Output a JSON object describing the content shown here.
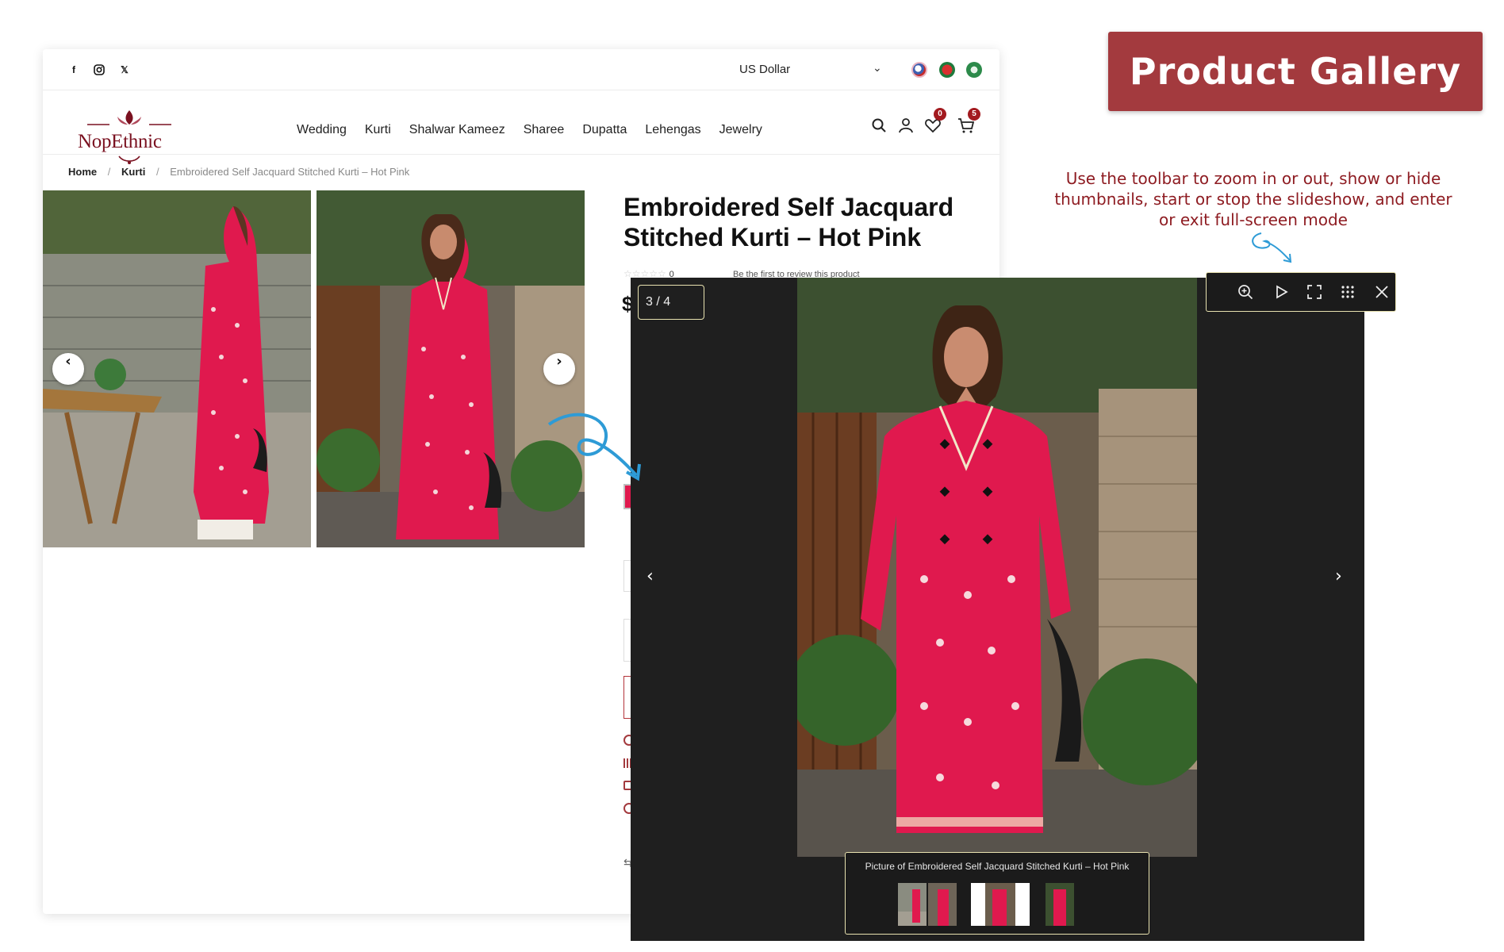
{
  "social": [
    "f",
    "ig",
    "x"
  ],
  "currency": {
    "label": "US Dollar"
  },
  "logo": {
    "name": "NopEthnic"
  },
  "nav": [
    "Wedding",
    "Kurti",
    "Shalwar Kameez",
    "Sharee",
    "Dupatta",
    "Lehengas",
    "Jewelry"
  ],
  "header_badges": {
    "wishlist": "0",
    "cart": "5"
  },
  "breadcrumb": {
    "home": "Home",
    "category": "Kurti",
    "current": "Embroidered Self Jacquard Stitched Kurti – Hot Pink"
  },
  "product": {
    "title": "Embroidered Self Jacquard Stitched Kurti – Hot Pink",
    "rating_count": "0",
    "review_link": "Be the first to review this product",
    "price_symbol": "$"
  },
  "lightbox": {
    "counter": "3 / 4",
    "caption": "Picture of Embroidered Self Jacquard Stitched Kurti – Hot Pink"
  },
  "annotation": {
    "tag": "Product Gallery",
    "note": "Use the toolbar to zoom in or out, show or hide thumbnails, start or stop the slideshow, and enter or exit full-screen mode"
  },
  "colors": {
    "accent": "#a33a3e",
    "brand": "#7a1120",
    "dress": "#e0194e"
  }
}
